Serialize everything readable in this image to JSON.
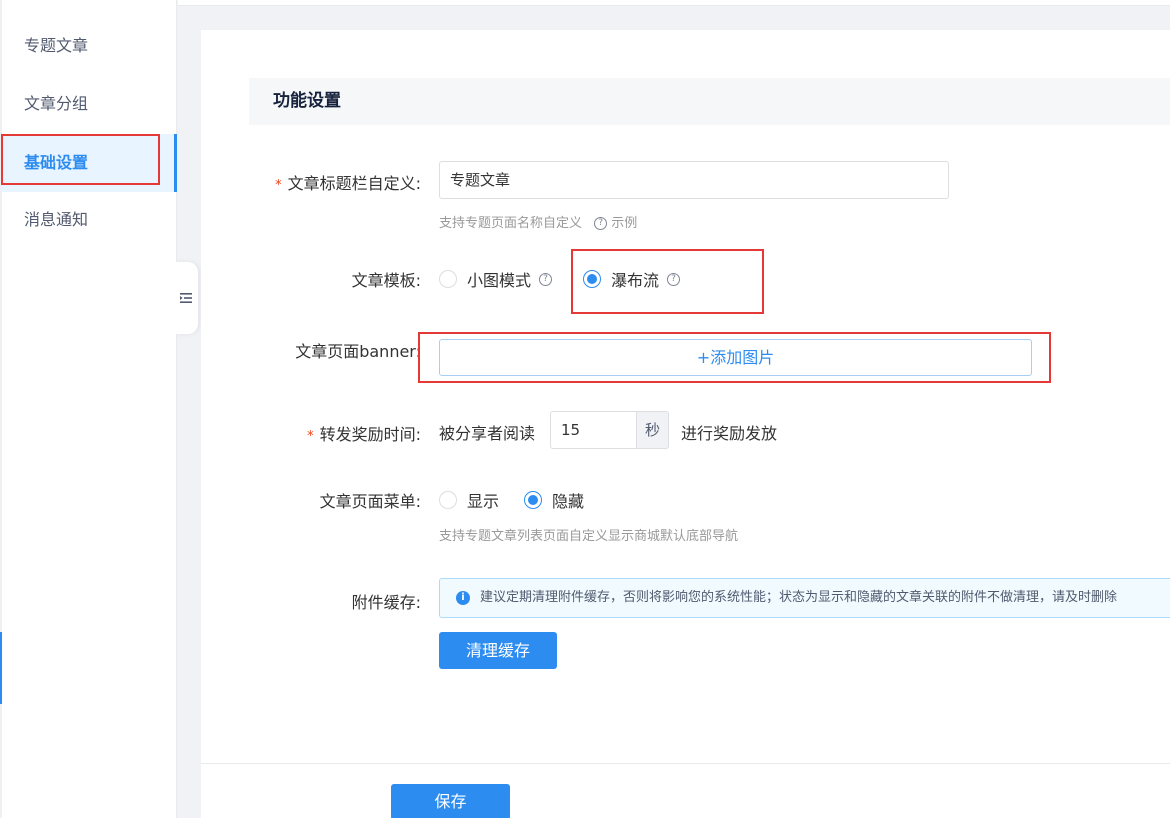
{
  "sidebar": {
    "items": [
      {
        "label": "专题文章",
        "active": false
      },
      {
        "label": "文章分组",
        "active": false
      },
      {
        "label": "基础设置",
        "active": true
      },
      {
        "label": "消息通知",
        "active": false
      }
    ]
  },
  "section": {
    "title": "功能设置"
  },
  "form": {
    "title_field": {
      "label": "文章标题栏自定义:",
      "required_mark": "*",
      "value": "专题文章",
      "hint": "支持专题页面名称自定义",
      "hint_link": "示例"
    },
    "template": {
      "label": "文章模板:",
      "options": [
        {
          "label": "小图模式",
          "checked": false
        },
        {
          "label": "瀑布流",
          "checked": true
        }
      ]
    },
    "banner": {
      "label": "文章页面banner:",
      "button": "+添加图片"
    },
    "reward_time": {
      "label": "转发奖励时间:",
      "required_mark": "*",
      "prefix": "被分享者阅读",
      "value": "15",
      "unit": "秒",
      "suffix": "进行奖励发放"
    },
    "page_menu": {
      "label": "文章页面菜单:",
      "options": [
        {
          "label": "显示",
          "checked": false
        },
        {
          "label": "隐藏",
          "checked": true
        }
      ],
      "hint": "支持专题文章列表页面自定义显示商城默认底部导航"
    },
    "cache": {
      "label": "附件缓存:",
      "alert": "建议定期清理附件缓存，否则将影响您的系统性能；状态为显示和隐藏的文章关联的附件不做清理，请及时删除",
      "button": "清理缓存"
    }
  },
  "footer": {
    "save": "保存"
  },
  "icons": {
    "help": "?",
    "info": "i"
  },
  "colors": {
    "primary": "#2d8cf0",
    "highlight_box": "#e53935",
    "required": "#ed4014"
  }
}
